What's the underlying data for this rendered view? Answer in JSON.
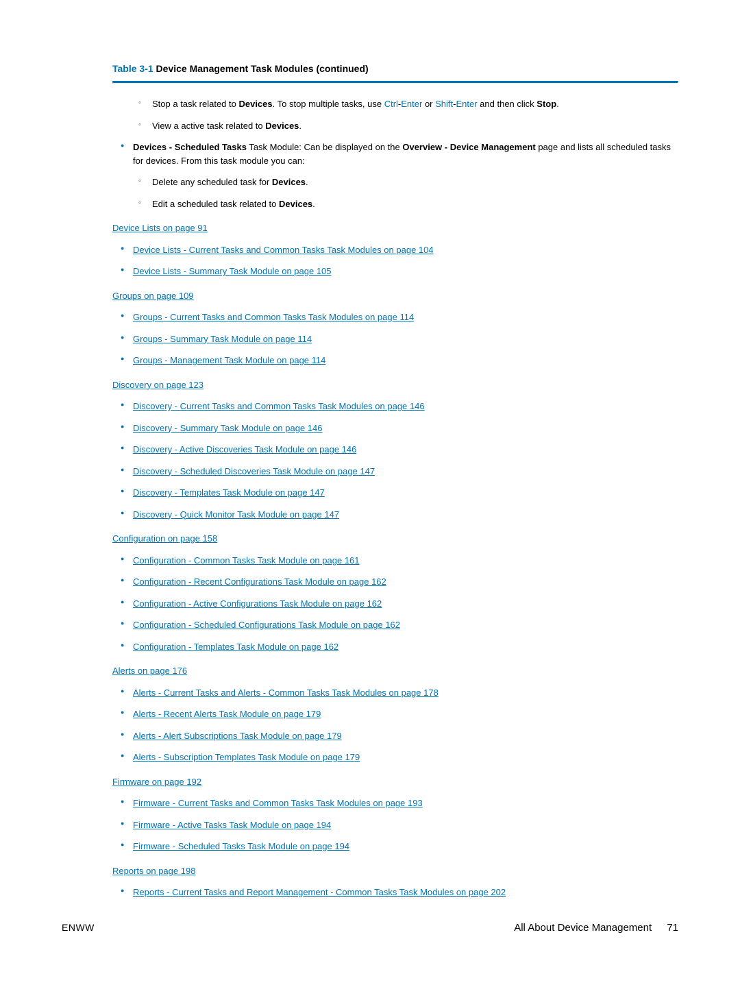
{
  "caption": {
    "label": "Table 3-1",
    "title": "Device Management Task Modules (continued)"
  },
  "intro": {
    "sub1_prefix": "Stop a task related to ",
    "sub1_bold1": "Devices",
    "sub1_mid": ". To stop multiple tasks, use ",
    "sub1_key1": "Ctrl",
    "sub1_dash1": "-",
    "sub1_key2": "Enter",
    "sub1_or": " or ",
    "sub1_key3": "Shift",
    "sub1_dash2": "-",
    "sub1_key4": "Enter",
    "sub1_after": " and then click ",
    "sub1_bold2": "Stop",
    "sub1_end": ".",
    "sub2_prefix": "View a active task related to ",
    "sub2_bold": "Devices",
    "sub2_end": ".",
    "main_bold1": "Devices - Scheduled Tasks",
    "main_text1": " Task Module: Can be displayed on the ",
    "main_bold2": "Overview - Device Management",
    "main_text2": " page and lists all scheduled tasks for devices. From this task module you can:",
    "sub3_prefix": "Delete any scheduled task for ",
    "sub3_bold": "Devices",
    "sub3_end": ".",
    "sub4_prefix": "Edit a scheduled task related to ",
    "sub4_bold": "Devices",
    "sub4_end": "."
  },
  "sections": [
    {
      "heading": "Device Lists on page 91",
      "items": [
        "Device Lists - Current Tasks and Common Tasks Task Modules on page 104",
        "Device Lists - Summary Task Module on page 105"
      ]
    },
    {
      "heading": "Groups on page 109",
      "items": [
        "Groups - Current Tasks and Common Tasks Task Modules on page 114",
        "Groups - Summary Task Module on page 114",
        "Groups - Management Task Module on page 114"
      ]
    },
    {
      "heading": "Discovery on page 123",
      "items": [
        "Discovery - Current Tasks and Common Tasks Task Modules on page 146",
        "Discovery - Summary Task Module on page 146",
        "Discovery - Active Discoveries Task Module on page 146",
        "Discovery - Scheduled Discoveries Task Module on page 147",
        "Discovery - Templates Task Module on page 147",
        "Discovery - Quick Monitor Task Module on page 147"
      ]
    },
    {
      "heading": "Configuration on page 158",
      "items": [
        "Configuration - Common Tasks Task Module on page 161",
        "Configuration - Recent Configurations Task Module on page 162",
        "Configuration - Active Configurations Task Module on page 162",
        "Configuration - Scheduled Configurations Task Module on page 162",
        "Configuration - Templates Task Module on page 162"
      ]
    },
    {
      "heading": "Alerts on page 176",
      "items": [
        "Alerts - Current Tasks and Alerts - Common Tasks Task Modules on page 178",
        "Alerts - Recent Alerts Task Module on page 179",
        "Alerts - Alert Subscriptions Task Module on page 179",
        "Alerts - Subscription Templates Task Module on page 179"
      ]
    },
    {
      "heading": "Firmware on page 192",
      "items": [
        "Firmware - Current Tasks and Common Tasks Task Modules on page 193",
        "Firmware - Active Tasks Task Module on page 194",
        "Firmware - Scheduled Tasks Task Module on page 194"
      ]
    },
    {
      "heading": "Reports on page 198",
      "items": [
        "Reports - Current Tasks and Report Management - Common Tasks Task Modules on page 202"
      ]
    }
  ],
  "footer": {
    "left": "ENWW",
    "right": "All About Device Management",
    "page": "71"
  }
}
